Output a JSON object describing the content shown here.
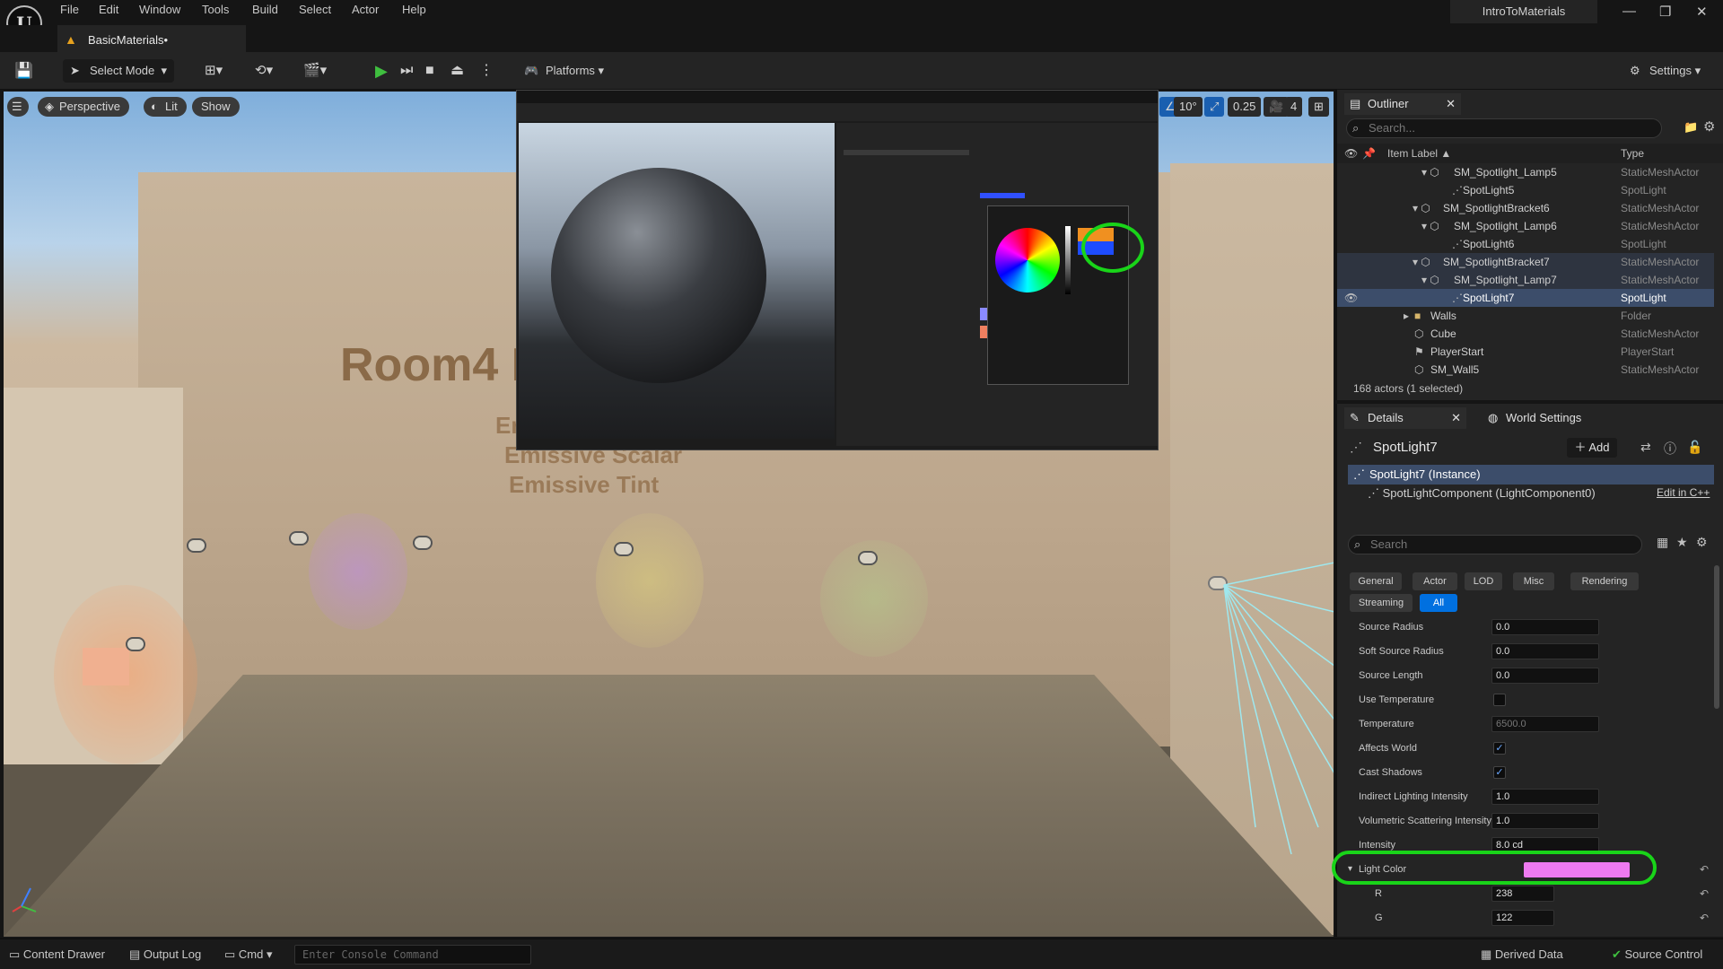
{
  "window": {
    "menus": [
      "File",
      "Edit",
      "Window",
      "Tools",
      "Build",
      "Select",
      "Actor",
      "Help"
    ],
    "project_name": "IntroToMaterials",
    "doc_tab": "BasicMaterials•"
  },
  "toolbar": {
    "select_mode": "Select Mode",
    "platforms": "Platforms",
    "settings": "Settings"
  },
  "viewport": {
    "perspective": "Perspective",
    "lit": "Lit",
    "show": "Show",
    "angle": "10°",
    "scale": "0.25",
    "camera_speed": "4",
    "wall_text": {
      "title": "Room4 E",
      "em_partial": "Er",
      "emissive_scalar": "Emissive Scalar",
      "emissive_tint": "Emissive Tint"
    }
  },
  "outliner": {
    "tab": "Outliner",
    "search_placeholder": "Search...",
    "col_label": "Item Label",
    "col_type": "Type",
    "rows": [
      {
        "name": "SM_Spotlight_Lamp5",
        "type": "StaticMeshActor"
      },
      {
        "name": "SpotLight5",
        "type": "SpotLight"
      },
      {
        "name": "SM_SpotlightBracket6",
        "type": "StaticMeshActor"
      },
      {
        "name": "SM_Spotlight_Lamp6",
        "type": "StaticMeshActor"
      },
      {
        "name": "SpotLight6",
        "type": "SpotLight"
      },
      {
        "name": "SM_SpotlightBracket7",
        "type": "StaticMeshActor"
      },
      {
        "name": "SM_Spotlight_Lamp7",
        "type": "StaticMeshActor"
      },
      {
        "name": "SpotLight7",
        "type": "SpotLight"
      },
      {
        "name": "Walls",
        "type": "Folder"
      },
      {
        "name": "Cube",
        "type": "StaticMeshActor"
      },
      {
        "name": "PlayerStart",
        "type": "PlayerStart"
      },
      {
        "name": "SM_Wall5",
        "type": "StaticMeshActor"
      }
    ],
    "count": "168 actors (1 selected)"
  },
  "details": {
    "tab": "Details",
    "world_settings_tab": "World Settings",
    "actor_name": "SpotLight7",
    "add": "Add",
    "instance": "SpotLight7 (Instance)",
    "component": "SpotLightComponent (LightComponent0)",
    "edit_cpp": "Edit in C++",
    "search_placeholder": "Search",
    "filters": [
      "General",
      "Actor",
      "LOD",
      "Misc",
      "Rendering",
      "Streaming",
      "All"
    ],
    "props": {
      "source_radius": {
        "label": "Source Radius",
        "value": "0.0"
      },
      "soft_source_radius": {
        "label": "Soft Source Radius",
        "value": "0.0"
      },
      "source_length": {
        "label": "Source Length",
        "value": "0.0"
      },
      "use_temperature": {
        "label": "Use Temperature",
        "checked": false
      },
      "temperature": {
        "label": "Temperature",
        "value": "6500.0"
      },
      "affects_world": {
        "label": "Affects World",
        "checked": true
      },
      "cast_shadows": {
        "label": "Cast Shadows",
        "checked": true
      },
      "indirect": {
        "label": "Indirect Lighting Intensity",
        "value": "1.0"
      },
      "volumetric": {
        "label": "Volumetric Scattering Intensity",
        "value": "1.0"
      },
      "intensity": {
        "label": "Intensity",
        "value": "8.0 cd"
      },
      "light_color": {
        "label": "Light Color",
        "color": "#ee7af0"
      },
      "r": {
        "label": "R",
        "value": "238"
      },
      "g": {
        "label": "G",
        "value": "122"
      }
    }
  },
  "statusbar": {
    "content_drawer": "Content Drawer",
    "output_log": "Output Log",
    "cmd": "Cmd",
    "console_placeholder": "Enter Console Command",
    "derived_data": "Derived Data",
    "source_control": "Source Control"
  },
  "colors": {
    "highlight_circle": "#19d419",
    "selection": "#3c4d6a",
    "accent_blue": "#0070e0"
  }
}
